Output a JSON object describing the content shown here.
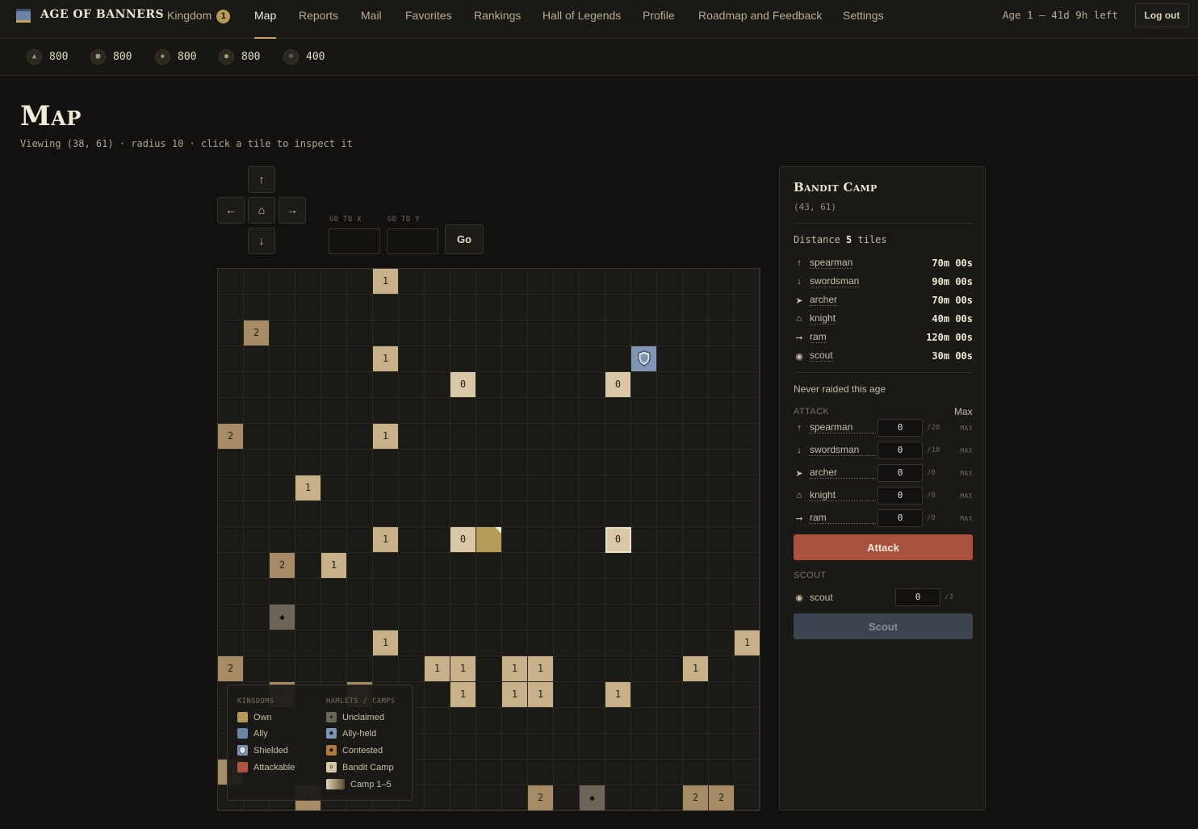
{
  "brand": {
    "title": "AGE OF BANNERS"
  },
  "nav": {
    "kingdom": "Kingdom",
    "kingdom_badge": "1",
    "map": "Map",
    "reports": "Reports",
    "mail": "Mail",
    "favorites": "Favorites",
    "rankings": "Rankings",
    "hall": "Hall of Legends",
    "profile": "Profile",
    "roadmap": "Roadmap and Feedback",
    "settings": "Settings"
  },
  "age_status": "Age 1 — 41d 9h left",
  "logout_label": "Log out",
  "resources": [
    {
      "icon": "▲",
      "value": "800"
    },
    {
      "icon": "■",
      "value": "800"
    },
    {
      "icon": "◆",
      "value": "800"
    },
    {
      "icon": "●",
      "value": "800"
    },
    {
      "icon": "⊖",
      "value": "400"
    }
  ],
  "page": {
    "title": "Map",
    "subtitle": "Viewing (38, 61) · radius 10 · click a tile to inspect it"
  },
  "controls": {
    "up": "↑",
    "left": "←",
    "home": "⌂",
    "right": "→",
    "down": "↓",
    "goto_x": "GO TO X",
    "goto_y": "GO TO Y",
    "go": "Go",
    "x_value": "",
    "y_value": ""
  },
  "legend": {
    "kingdoms_header": "KINGDOMS",
    "hamlets_header": "HAMLETS / CAMPS",
    "own": "Own",
    "ally": "Ally",
    "shielded": "Shielded",
    "attackable": "Attackable",
    "unclaimed": "Unclaimed",
    "ally_held": "Ally-held",
    "contested": "Contested",
    "bandit_camp": "Bandit Camp",
    "camp_range": "Camp 1–5",
    "colors": {
      "own": "#b39a57",
      "ally": "#6d83a8",
      "shielded": "#8094b0",
      "attackable": "#b0533f",
      "unclaimed": "#6c6558",
      "ally_held": "#7e95b3",
      "contested": "#b37a3f",
      "bandit": "#d9c8a6"
    }
  },
  "map_tiles": [
    {
      "c": 6,
      "r": 0,
      "k": "c1",
      "t": "1"
    },
    {
      "c": 1,
      "r": 2,
      "k": "c2",
      "t": "2"
    },
    {
      "c": 6,
      "r": 3,
      "k": "c1",
      "t": "1"
    },
    {
      "c": 16,
      "r": 3,
      "k": "shield",
      "t": ""
    },
    {
      "c": 9,
      "r": 4,
      "k": "c0",
      "t": "0"
    },
    {
      "c": 15,
      "r": 4,
      "k": "c0",
      "t": "0"
    },
    {
      "c": 0,
      "r": 6,
      "k": "c2",
      "t": "2"
    },
    {
      "c": 6,
      "r": 6,
      "k": "c1",
      "t": "1"
    },
    {
      "c": 3,
      "r": 8,
      "k": "c1",
      "t": "1"
    },
    {
      "c": 6,
      "r": 10,
      "k": "c1",
      "t": "1"
    },
    {
      "c": 9,
      "r": 10,
      "k": "c0",
      "t": "0"
    },
    {
      "c": 10,
      "r": 10,
      "k": "own",
      "t": ""
    },
    {
      "c": 15,
      "r": 10,
      "k": "c0sel",
      "t": "0"
    },
    {
      "c": 2,
      "r": 11,
      "k": "c2",
      "t": "2"
    },
    {
      "c": 4,
      "r": 11,
      "k": "c1",
      "t": "1"
    },
    {
      "c": 2,
      "r": 13,
      "k": "unc",
      "t": "◆"
    },
    {
      "c": 6,
      "r": 14,
      "k": "c1",
      "t": "1"
    },
    {
      "c": 20,
      "r": 14,
      "k": "c1",
      "t": "1"
    },
    {
      "c": 0,
      "r": 15,
      "k": "c2",
      "t": "2"
    },
    {
      "c": 8,
      "r": 15,
      "k": "c1",
      "t": "1"
    },
    {
      "c": 9,
      "r": 15,
      "k": "c1",
      "t": "1"
    },
    {
      "c": 11,
      "r": 15,
      "k": "c1",
      "t": "1"
    },
    {
      "c": 12,
      "r": 15,
      "k": "c1",
      "t": "1"
    },
    {
      "c": 18,
      "r": 15,
      "k": "c1",
      "t": "1"
    },
    {
      "c": 2,
      "r": 16,
      "k": "c2",
      "t": "2"
    },
    {
      "c": 5,
      "r": 16,
      "k": "c2",
      "t": ""
    },
    {
      "c": 9,
      "r": 16,
      "k": "c1",
      "t": "1"
    },
    {
      "c": 11,
      "r": 16,
      "k": "c1",
      "t": "1"
    },
    {
      "c": 12,
      "r": 16,
      "k": "c1",
      "t": "1"
    },
    {
      "c": 15,
      "r": 16,
      "k": "c1",
      "t": "1"
    },
    {
      "c": 0,
      "r": 19,
      "k": "c2",
      "t": "2"
    },
    {
      "c": 3,
      "r": 20,
      "k": "c2",
      "t": "2"
    },
    {
      "c": 12,
      "r": 20,
      "k": "c2",
      "t": "2"
    },
    {
      "c": 14,
      "r": 20,
      "k": "unc",
      "t": "◆"
    },
    {
      "c": 18,
      "r": 20,
      "k": "c2",
      "t": "2"
    },
    {
      "c": 19,
      "r": 20,
      "k": "c2",
      "t": "2"
    }
  ],
  "panel": {
    "title": "Bandit Camp",
    "coords": "(43, 61)",
    "distance_label": "Distance",
    "distance_value": "5",
    "distance_unit": "tiles",
    "travel": [
      {
        "icon": "↑",
        "name": "spearman",
        "time": "70m 00s"
      },
      {
        "icon": "↓",
        "name": "swordsman",
        "time": "90m 00s"
      },
      {
        "icon": "➤",
        "name": "archer",
        "time": "70m 00s"
      },
      {
        "icon": "⌂",
        "name": "knight",
        "time": "40m 00s"
      },
      {
        "icon": "➞",
        "name": "ram",
        "time": "120m 00s"
      },
      {
        "icon": "◉",
        "name": "scout",
        "time": "30m 00s"
      }
    ],
    "never_raided": "Never raided this age",
    "attack_header": "ATTACK",
    "max_all": "Max",
    "attack_units": [
      {
        "icon": "↑",
        "name": "spearman",
        "qty": "0",
        "avail": "/20",
        "max": "MAX"
      },
      {
        "icon": "↓",
        "name": "swordsman",
        "qty": "0",
        "avail": "/10",
        "max": "MAX"
      },
      {
        "icon": "➤",
        "name": "archer",
        "qty": "0",
        "avail": "/0",
        "max": "MAX"
      },
      {
        "icon": "⌂",
        "name": "knight",
        "qty": "0",
        "avail": "/0",
        "max": "MAX"
      },
      {
        "icon": "➞",
        "name": "ram",
        "qty": "0",
        "avail": "/0",
        "max": "MAX"
      }
    ],
    "attack_button": "Attack",
    "scout_header": "SCOUT",
    "scout_unit": {
      "icon": "◉",
      "name": "scout",
      "qty": "0",
      "avail": "/3"
    },
    "scout_button": "Scout"
  }
}
